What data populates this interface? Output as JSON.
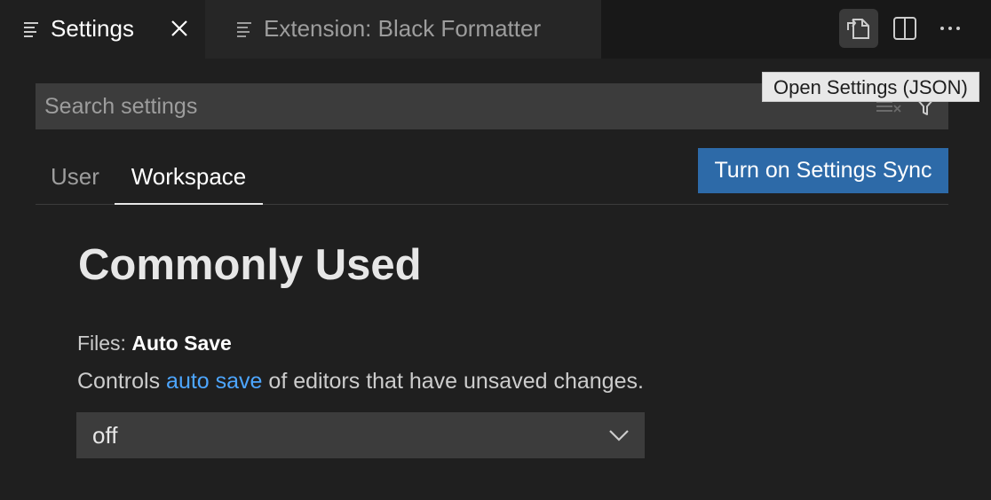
{
  "tabs": [
    {
      "label": "Settings",
      "icon": "settings-file-icon",
      "active": true
    },
    {
      "label": "Extension: Black Formatter",
      "icon": "preview-icon",
      "active": false
    }
  ],
  "editor_actions": {
    "open_json_icon": "open-settings-json-icon",
    "split_icon": "split-editor-icon",
    "more_icon": "more-actions-icon",
    "tooltip": "Open Settings (JSON)"
  },
  "search": {
    "placeholder": "Search settings",
    "value": ""
  },
  "scopes": {
    "user": "User",
    "workspace": "Workspace",
    "selected": "Workspace"
  },
  "sync_button": "Turn on Settings Sync",
  "section": {
    "title": "Commonly Used"
  },
  "setting": {
    "category": "Files: ",
    "name": "Auto Save",
    "desc_before": "Controls ",
    "desc_link": "auto save",
    "desc_after": " of editors that have unsaved changes.",
    "value": "off"
  },
  "colors": {
    "accent_button": "#2d6aa8",
    "link": "#4da6ff",
    "background": "#1f1f1f"
  }
}
